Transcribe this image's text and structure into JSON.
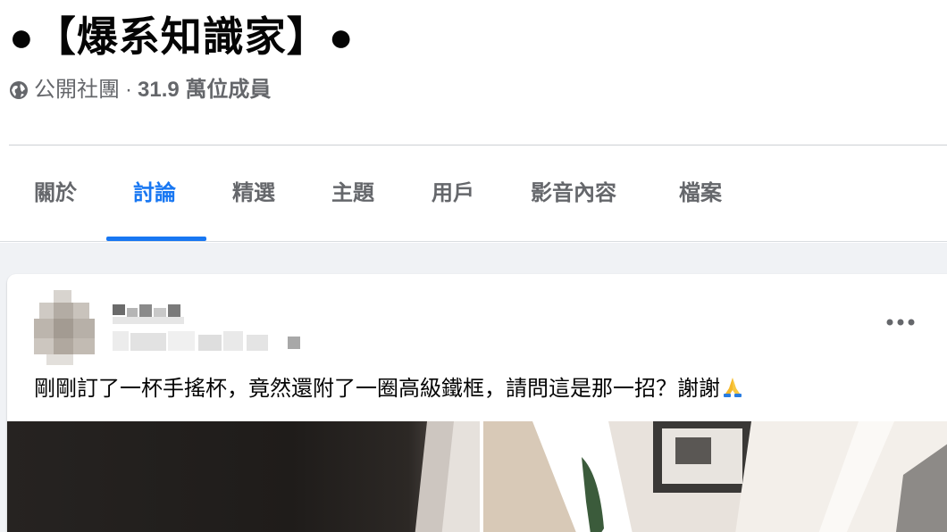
{
  "group": {
    "title": "●【爆系知識家】●",
    "privacy": "公開社團",
    "separator": "·",
    "members": "31.9 萬位成員"
  },
  "tabs": [
    {
      "label": "關於"
    },
    {
      "label": "討論"
    },
    {
      "label": "精選"
    },
    {
      "label": "主題"
    },
    {
      "label": "用戶"
    },
    {
      "label": "影音內容"
    },
    {
      "label": "檔案"
    }
  ],
  "active_tab": "討論",
  "post": {
    "text": "剛剛訂了一杯手搖杯，竟然還附了一圈高級鐵框，請問這是那一招？謝謝",
    "more_icon": "more-horizontal-icon",
    "emoji_icon": "folded-hands-icon"
  },
  "colors": {
    "accent": "#1877f2",
    "secondary_text": "#65676b",
    "feed_background": "#f0f2f5"
  }
}
